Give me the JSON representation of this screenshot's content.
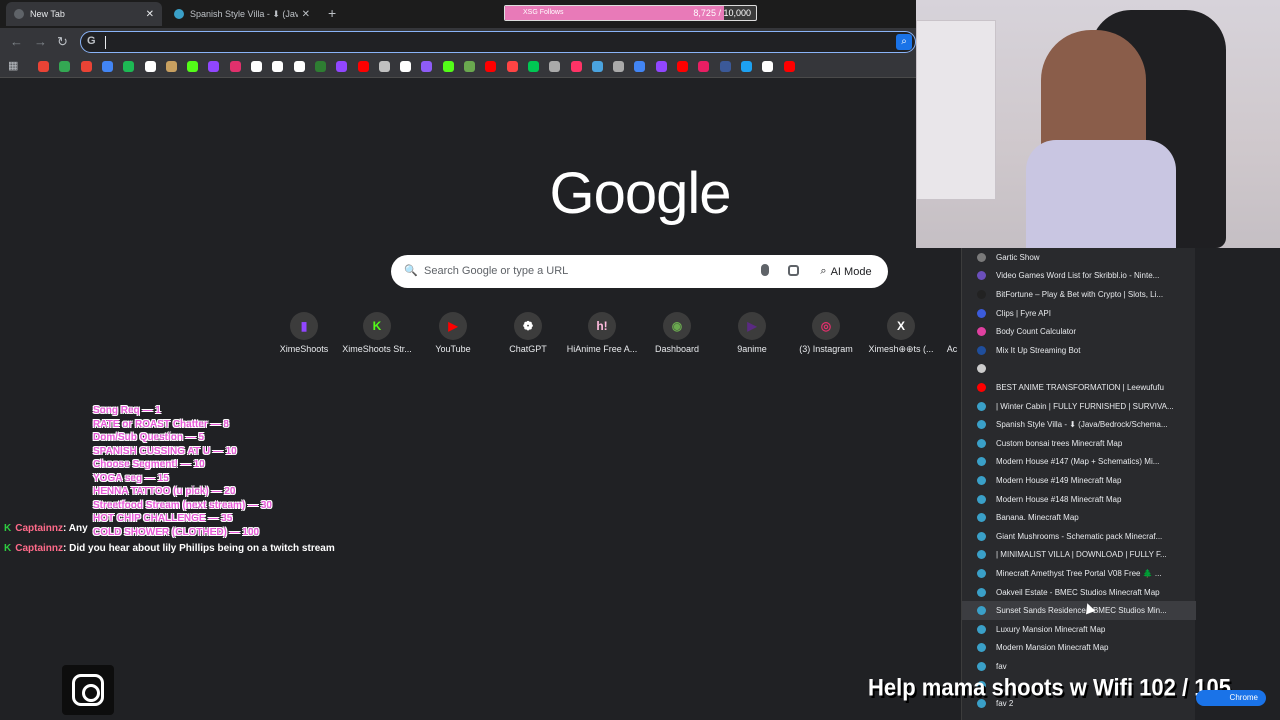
{
  "tabs": [
    {
      "title": "New Tab",
      "active": true
    },
    {
      "title": "Spanish Style Villa - ⬇ (Java/Bedrock/Schema...",
      "active": false
    }
  ],
  "omnibox": {
    "value": "",
    "g_label": "G"
  },
  "follows_goal": {
    "label": "XSG Follows",
    "current": "8,725",
    "target": "10,000",
    "progress": 0.8725
  },
  "google_logo": "Google",
  "search": {
    "placeholder": "Search Google or type a URL",
    "ai_mode_label": "AI Mode"
  },
  "shortcuts": [
    {
      "label": "XimeShoots",
      "icon": "twitch-icon",
      "glyph": "▮",
      "color": "#9146ff"
    },
    {
      "label": "XimeShoots Str...",
      "icon": "kick-icon",
      "glyph": "K",
      "color": "#53fc18"
    },
    {
      "label": "YouTube",
      "icon": "youtube-icon",
      "glyph": "▶",
      "color": "#ff0000"
    },
    {
      "label": "ChatGPT",
      "icon": "chatgpt-icon",
      "glyph": "❁",
      "color": "#ffffff"
    },
    {
      "label": "HiAnime Free A...",
      "icon": "hianime-icon",
      "glyph": "h!",
      "color": "#ffbade"
    },
    {
      "label": "Dashboard",
      "icon": "dashboard-icon",
      "glyph": "◉",
      "color": "#6aa84f"
    },
    {
      "label": "9anime",
      "icon": "9anime-icon",
      "glyph": "▶",
      "color": "#5a2a82"
    },
    {
      "label": "(3) Instagram",
      "icon": "instagram-icon",
      "glyph": "◎",
      "color": "#e1306c"
    },
    {
      "label": "Ximesh⊕⊕ts (...",
      "icon": "x-icon",
      "glyph": "X",
      "color": "#ffffff"
    },
    {
      "label": "Ac",
      "icon": "partial-icon",
      "glyph": "",
      "color": "#3c3c3c"
    }
  ],
  "bookmarks_menu": [
    {
      "label": "Gartic Show",
      "color": "#7a7a7a"
    },
    {
      "label": "Video Games Word List for Skribbl.io - Ninte...",
      "color": "#6b4fbb"
    },
    {
      "label": "BitFortune – Play & Bet with Crypto | Slots, Li...",
      "color": "#222222"
    },
    {
      "label": "Clips | Fyre API",
      "color": "#3b5bdb"
    },
    {
      "label": "Body Count Calculator",
      "color": "#e040a0"
    },
    {
      "label": "Mix It Up Streaming Bot",
      "color": "#1f4e9c"
    },
    {
      "label": "",
      "color": "#cccccc"
    },
    {
      "label": "BEST ANIME TRANSFORMATION | Leewufufu",
      "color": "#ff0000"
    },
    {
      "label": "| Winter Cabin | FULLY FURNISHED | SURVIVA...",
      "color": "#3aa0c8"
    },
    {
      "label": "Spanish Style Villa - ⬇ (Java/Bedrock/Schema...",
      "color": "#3aa0c8"
    },
    {
      "label": "Custom bonsai trees Minecraft Map",
      "color": "#3aa0c8"
    },
    {
      "label": "Modern House #147 (Map + Schematics) Mi...",
      "color": "#3aa0c8"
    },
    {
      "label": "Modern House #149 Minecraft Map",
      "color": "#3aa0c8"
    },
    {
      "label": "Modern House #148 Minecraft Map",
      "color": "#3aa0c8"
    },
    {
      "label": "Banana. Minecraft Map",
      "color": "#3aa0c8"
    },
    {
      "label": "Giant Mushrooms - Schematic pack Minecraf...",
      "color": "#3aa0c8"
    },
    {
      "label": "| MINIMALIST VILLA | DOWNLOAD | FULLY F...",
      "color": "#3aa0c8"
    },
    {
      "label": "Minecraft Amethyst Tree Portal V08 Free 🌲 ...",
      "color": "#3aa0c8"
    },
    {
      "label": "Oakveil Estate - BMEC Studios Minecraft Map",
      "color": "#3aa0c8"
    },
    {
      "label": "Sunset Sands Residence - BMEC Studios Min...",
      "color": "#3aa0c8"
    },
    {
      "label": "Luxury Mansion Minecraft Map",
      "color": "#3aa0c8"
    },
    {
      "label": "Modern Mansion Minecraft Map",
      "color": "#3aa0c8"
    },
    {
      "label": "fav",
      "color": "#3aa0c8"
    },
    {
      "label": "",
      "color": "#3aa0c8"
    },
    {
      "label": "fav 2",
      "color": "#3aa0c8"
    }
  ],
  "overlay_menu": [
    "Song Req — 1",
    "RATE or ROAST Chatter — 8",
    "Dom/Sub Question — 5",
    "SPANISH CUSSING AT U — 10",
    "Choose Segment! — 10",
    "YOGA seg — 15",
    "HENNA TATTOO (u pick) — 20",
    "Streetfood Stream (next stream) — 30",
    "HOT CHIP CHALLENGE — 35",
    "COLD SHOWER (CLOTHED) — 100"
  ],
  "chat": [
    {
      "user": "Captainnz",
      "message": ": Any"
    },
    {
      "user": "Captainnz",
      "message": ": Did you hear about lily Phillips being on a twitch stream"
    }
  ],
  "goal_text": "Help mama shoots w Wifi  102 / 105",
  "chrome_pill": "Chrome"
}
